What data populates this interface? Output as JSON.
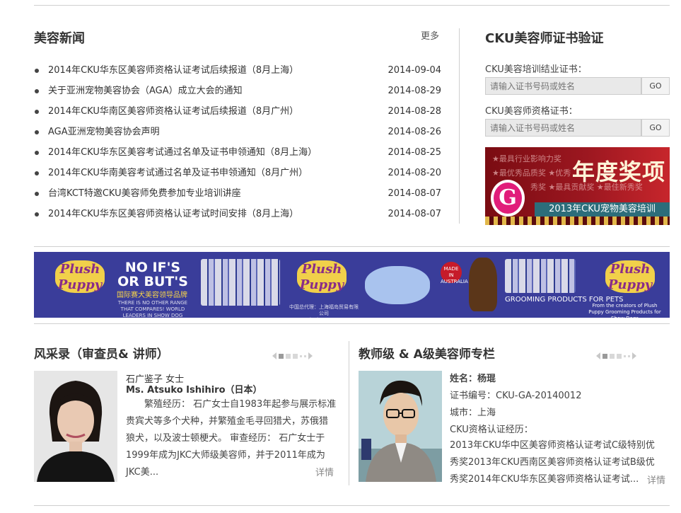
{
  "news": {
    "title": "美容新闻",
    "more": "更多",
    "items": [
      {
        "text": "2014年CKU华东区美容师资格认证考试后续报道（8月上海）",
        "date": "2014-09-04"
      },
      {
        "text": "关于亚洲宠物美容协会（AGA）成立大会的通知",
        "date": "2014-08-29"
      },
      {
        "text": "2014年CKU华南区美容师资格认证考试后续报道（8月广州）",
        "date": "2014-08-28"
      },
      {
        "text": "AGA亚洲宠物美容协会声明",
        "date": "2014-08-26"
      },
      {
        "text": "2014年CKU华东区美容考试通过名单及证书申领通知（8月上海）",
        "date": "2014-08-25"
      },
      {
        "text": "2014年CKU华南美容考试通过名单及证书申领通知（8月广州）",
        "date": "2014-08-20"
      },
      {
        "text": "台湾KCT特邀CKU美容师免费参加专业培训讲座",
        "date": "2014-08-07"
      },
      {
        "text": "2014年CKU华东区美容师资格认证考试时间安排（8月上海）",
        "date": "2014-08-07"
      }
    ]
  },
  "verify": {
    "title": "CKU美容师证书验证",
    "field1_label": "CKU美容培训结业证书：",
    "field1_placeholder": "请输入证书号码或姓名",
    "field2_label": "CKU美容师资格证书：",
    "field2_placeholder": "请输入证书号码或姓名",
    "go": "GO"
  },
  "award": {
    "headline": "年度奖项",
    "stars1": "★最具行业影响力奖",
    "stars2": "★最优秀品质奖  ★优秀",
    "stars3": "秀奖  ★最具贡献奖  ★最佳新秀奖",
    "bar": "2013年CKU宠物美容培训",
    "logo_letter": "G"
  },
  "banner": {
    "brand": "Plush Puppy",
    "slogan": "NO IF'S OR BUT'S",
    "sub": "国际赛犬美容领导品牌",
    "sub_en": "THERE IS NO OTHER RANGE THAT COMPARES! WORLD LEADERS IN SHOW DOG GROOMING PRODUCTS",
    "agent": "中国总代理：上海福岛贸易有限公司 www.plushpuppy.com.cn",
    "made": "MADE IN AUSTRALIA",
    "grooming": "GROOMING PRODUCTS FOR PETS",
    "footer": "From the creators of Plush Puppy Grooming Products for Show Dogs"
  },
  "judges": {
    "title": "风采录（审查员& 讲师）",
    "name_cn": "石广鉴子   女士",
    "name_en": "Ms. Atsuko Ishihiro（日本）",
    "bio": "繁殖经历： 石广女士自1983年起参与展示标准贵宾犬等多个犬种，并繁殖金毛寻回猎犬，苏俄猎狼犬，以及波士顿梗犬。 审查经历： 石广女士于1999年成为JKC大师级美容师，并于2011年成为JKC美...",
    "more": "详情"
  },
  "teachers": {
    "title": "教师级 & A级美容师专栏",
    "name": "姓名：杨琨",
    "cert": "证书编号：CKU-GA-20140012",
    "city": "城市：上海",
    "exp_label": "CKU资格认证经历：",
    "exp": "2013年CKU华中区美容师资格认证考试C级特别优秀奖2013年CKU西南区美容师资格认证考试B级优秀奖2014年CKU华东区美容师资格认证考试...",
    "more": "详情"
  }
}
